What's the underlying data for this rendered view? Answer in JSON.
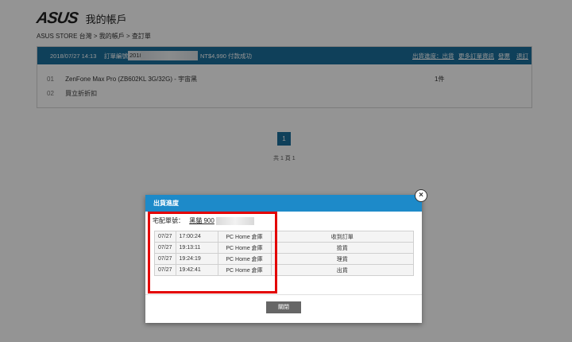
{
  "brand": {
    "logo": "ASUS",
    "account_title": "我的帳戶"
  },
  "breadcrumb": "ASUS STORE 台灣 > 我的帳戶 > 查訂單",
  "order": {
    "date": "2018/07/27 14:13",
    "order_no_label": "訂單編號：",
    "order_no_visible": "2018",
    "amount": "NT$4,990",
    "payment_status": "付款成功",
    "actions": [
      "出貨進度：出貨",
      "更多訂單資訊",
      "發票",
      "退訂"
    ],
    "items": [
      {
        "idx": "01",
        "name": "ZenFone Max Pro (ZB602KL 3G/32G) - 宇宙黑",
        "qty": "1件"
      },
      {
        "idx": "02",
        "name": "買立折折扣",
        "qty": ""
      }
    ]
  },
  "pagination": {
    "current": "1",
    "total_text": "共 1 頁 1"
  },
  "modal": {
    "title": "出貨進度",
    "tracking_label": "宅配單號：",
    "carrier": "黑貓 900",
    "rows": [
      {
        "date": "07/27",
        "time": "17:00:24",
        "warehouse": "PC Home 倉庫",
        "status": "收到訂單"
      },
      {
        "date": "07/27",
        "time": "19:13:11",
        "warehouse": "PC Home 倉庫",
        "status": "撿貨"
      },
      {
        "date": "07/27",
        "time": "19:24:19",
        "warehouse": "PC Home 倉庫",
        "status": "理貨"
      },
      {
        "date": "07/27",
        "time": "19:42:41",
        "warehouse": "PC Home 倉庫",
        "status": "出貨"
      }
    ],
    "close_label": "關閉",
    "close_icon": "×"
  },
  "colors": {
    "header_blue": "#1b6f9b",
    "modal_blue": "#1d8ac9",
    "highlight_red": "#e30000"
  }
}
